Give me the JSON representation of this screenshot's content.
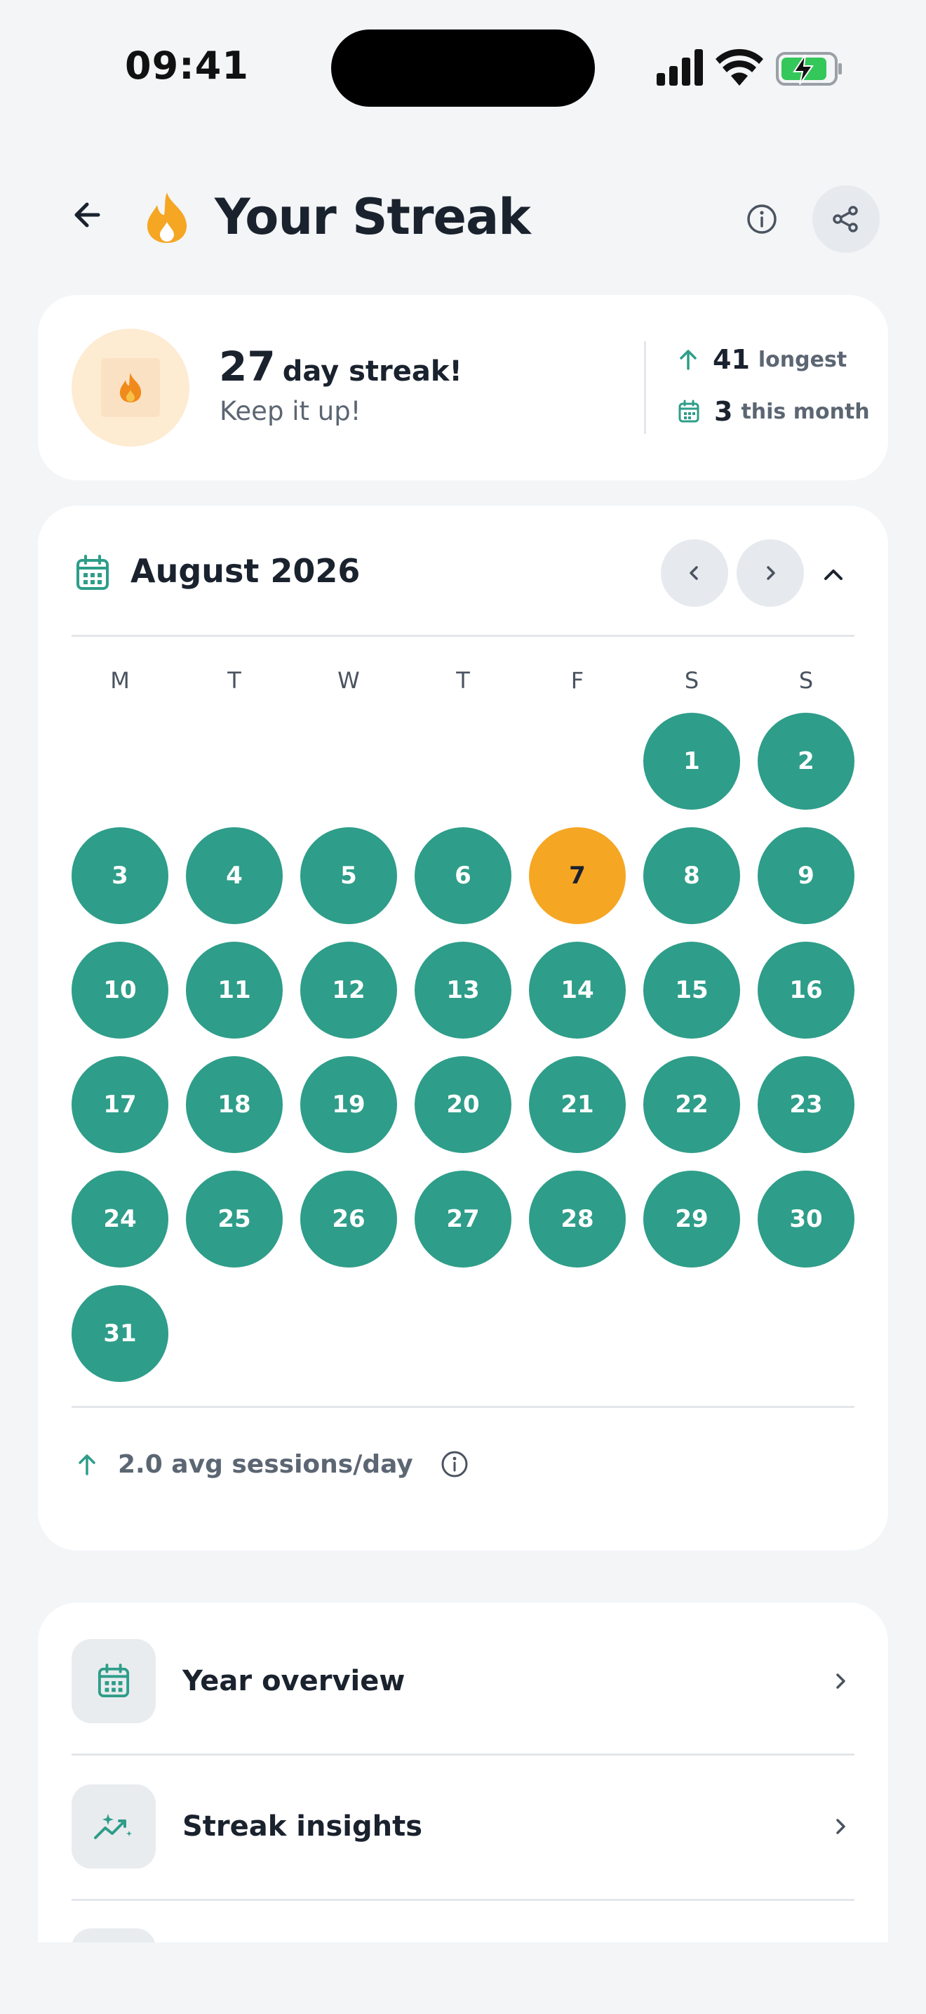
{
  "status_bar": {
    "time": "09:41"
  },
  "header": {
    "title": "Your Streak"
  },
  "summary": {
    "streak_count": "27",
    "streak_text": "day streak!",
    "subtitle": "Keep it up!",
    "longest_value": "41",
    "longest_label": "longest",
    "month_value": "3",
    "month_label": "this month"
  },
  "calendar": {
    "month": "August 2026",
    "weekdays": [
      "M",
      "T",
      "W",
      "T",
      "F",
      "S",
      "S"
    ],
    "first_weekday_index": 5,
    "days_in_month": 31,
    "today": 7,
    "completed_days": [
      1,
      2,
      3,
      4,
      5,
      6,
      7,
      8,
      9,
      10,
      11,
      12,
      13,
      14,
      15,
      16,
      17,
      18,
      19,
      20,
      21,
      22,
      23,
      24,
      25,
      26,
      27,
      28,
      29,
      30,
      31
    ],
    "avg_text": "2.0 avg sessions/day"
  },
  "menu": {
    "items": [
      {
        "label": "Year overview",
        "icon": "calendar-icon"
      },
      {
        "label": "Streak insights",
        "icon": "sparkle-chart-icon"
      }
    ]
  },
  "colors": {
    "accent_teal": "#2e9d89",
    "today_orange": "#f5a623",
    "flame_badge_bg": "#fdebd2",
    "battery_green": "#34c759"
  }
}
